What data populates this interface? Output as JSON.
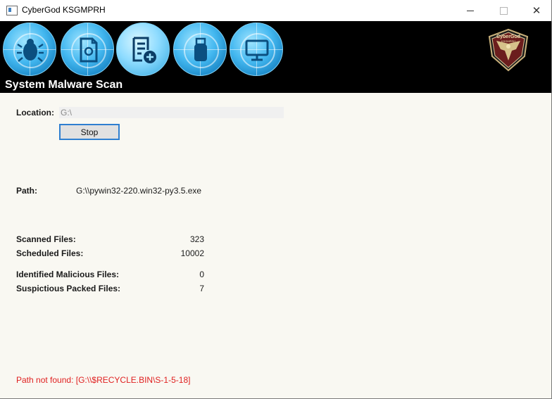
{
  "window": {
    "title": "CyberGod KSGMPRH",
    "controls": {
      "minimize": "minimize-icon",
      "maximize": "maximize-icon",
      "close": "close-icon"
    }
  },
  "header": {
    "title": "System Malware Scan",
    "tools": [
      {
        "name": "malware-bug-icon",
        "active": false
      },
      {
        "name": "file-scan-icon",
        "active": false
      },
      {
        "name": "add-document-icon",
        "active": true
      },
      {
        "name": "usb-drive-icon",
        "active": false
      },
      {
        "name": "computer-monitor-icon",
        "active": false
      }
    ],
    "logo": {
      "text_top": "CyberGod",
      "text_bottom": "KSGMPRH",
      "icon": "eagle-emblem-icon"
    }
  },
  "scan": {
    "location_label": "Location:",
    "location_value": "G:\\",
    "stop_label": "Stop",
    "path_label": "Path:",
    "path_value": "G:\\\\pywin32-220.win32-py3.5.exe",
    "stats": {
      "scanned_label": "Scanned Files:",
      "scanned_value": "323",
      "scheduled_label": "Scheduled Files:",
      "scheduled_value": "10002",
      "malicious_label": "Identified Malicious Files:",
      "malicious_value": "0",
      "packed_label": "Suspictious Packed Files:",
      "packed_value": "7"
    },
    "error_message": "Path not found: [G:\\\\$RECYCLE.BIN\\S-1-5-18]"
  },
  "colors": {
    "accent": "#2f7fd0",
    "error": "#e02020",
    "header_bg": "#000000",
    "content_bg": "#f9f8f2"
  }
}
